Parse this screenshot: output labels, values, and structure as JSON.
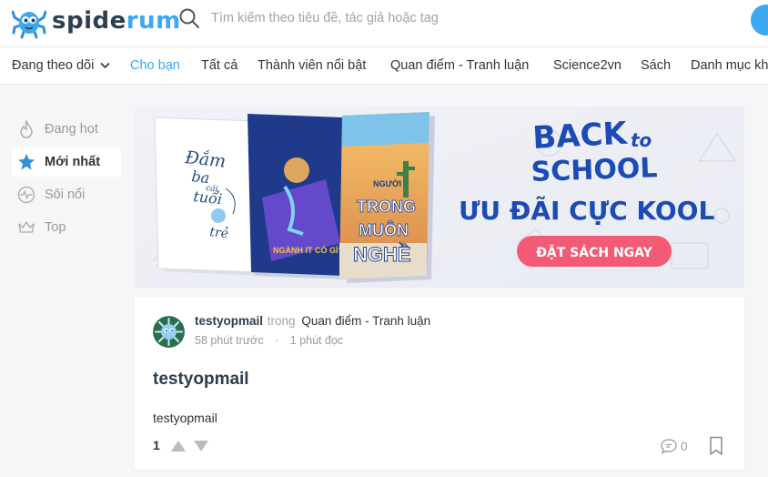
{
  "header": {
    "logo_part1": "spide",
    "logo_part2": "rum",
    "search_placeholder": "Tìm kiếm theo tiêu đề, tác giả hoặc tag"
  },
  "nav": {
    "items": [
      {
        "label": "Đang theo dõi"
      },
      {
        "label": "Cho bạn"
      },
      {
        "label": "Tất cả"
      },
      {
        "label": "Thành viên nổi bật"
      },
      {
        "label": "Quan điểm - Tranh luận"
      },
      {
        "label": "Science2vn"
      },
      {
        "label": "Sách"
      },
      {
        "label": "Danh mục khác"
      }
    ],
    "active": "Cho bạn"
  },
  "sidebar": {
    "items": [
      {
        "label": "Đang hot",
        "icon": "flame-icon"
      },
      {
        "label": "Mới nhất",
        "icon": "star-icon"
      },
      {
        "label": "Sôi nổi",
        "icon": "pulse-icon"
      },
      {
        "label": "Top",
        "icon": "crown-icon"
      }
    ],
    "active": "Mới nhất"
  },
  "banner": {
    "book1_title_1": "Đắm",
    "book1_title_2": "ba",
    "book1_title_3": "cái",
    "book1_title_4": "tuổi",
    "book1_title_5": "trẻ",
    "book2_title": "NGÀNH IT CÓ GÌ?",
    "book3_title_1": "NGƯỜI",
    "book3_title_2": "TRONG",
    "book3_title_3": "MUÔN",
    "book3_title_4": "NGHỀ",
    "headline_1": "BACK",
    "headline_2": "to",
    "headline_3": "SCHOOL",
    "subheadline": "ƯU ĐÃI CỰC KOOL",
    "cta": "ĐẶT SÁCH NGAY"
  },
  "post": {
    "author": "testyopmail",
    "in_word": "trong",
    "category": "Quan điểm - Tranh luận",
    "time_ago": "58 phút trước",
    "read_time": "1 phút đọc",
    "title": "testyopmail",
    "excerpt": "testyopmail",
    "votes": "1",
    "comments": "0"
  },
  "colors": {
    "accent": "#3ca8f2",
    "dark_text": "#2c3e50",
    "muted": "#999999",
    "banner_blue": "#1c4bb4",
    "banner_cta": "#f25a76"
  }
}
